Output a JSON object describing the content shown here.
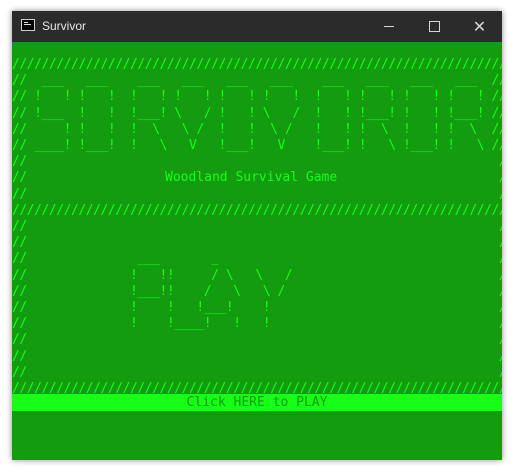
{
  "window": {
    "title": "Survivor",
    "controls": {
      "minimize": "minimize",
      "maximize": "maximize",
      "close": "close"
    }
  },
  "game": {
    "banner_ascii": "////////////////////////////////////////////////////////////////////\n//  ___   ___    ___   ___   ___   ___    ___   ___   ___   ___  //\n// !   ! !   !  !   ! !   ! !   ! !   !  !   ! !   ! !   ! !   ! //\n// !___  !   !  !___! \\   / !   ! \\   /  !   ! !___! !   ! !___! //\n//     ! !   !  !  \\   \\ /  !   !  \\ /   !   ! !  \\  !   ! !  \\  //\n// ____! !___!  !   \\   V   !___!   V    !___! !   \\ !___! !   \\ //\n//                                                                //\n//                                                                //\n//                                                                //\n////////////////////////////////////////////////////////////////////\n//                                                                //\n//                                                                //\n//               ___       _                                      //\n//              !   !!     / \\   \\   /                            //\n//              !___!!    /   \\   \\ /                             //\n//              !    !   !___!    !                               //\n//              !    !____!   !   !                               //\n//                                                                //\n//                                                                //\n//                                                                //\n////////////////////////////////////////////////////////////////////",
    "subtitle": "Woodland Survival Game",
    "click_label": "Click HERE to PLAY"
  }
}
